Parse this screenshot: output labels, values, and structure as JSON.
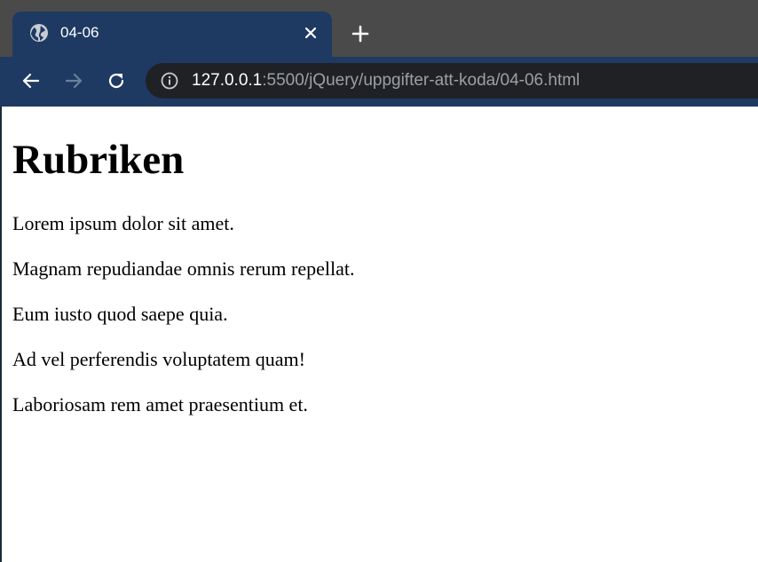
{
  "tab": {
    "title": "04-06",
    "favicon": "globe-icon",
    "close": "close-icon"
  },
  "toolbar": {
    "new_tab": "plus-icon",
    "back": "arrow-left-icon",
    "forward": "arrow-right-icon",
    "reload": "reload-icon",
    "info": "info-icon",
    "url_host": "127.0.0.1",
    "url_rest": ":5500/jQuery/uppgifter-att-koda/04-06.html"
  },
  "page": {
    "heading": "Rubriken",
    "paragraphs": [
      "Lorem ipsum dolor sit amet.",
      "Magnam repudiandae omnis rerum repellat.",
      "Eum iusto quod saepe quia.",
      "Ad vel perferendis voluptatem quam!",
      "Laboriosam rem amet praesentium et."
    ]
  },
  "colors": {
    "tab_strip": "#4a4a4a",
    "active_tab": "#1e3a63",
    "toolbar": "#1e3a63",
    "omnibox": "#202124",
    "url_host": "#ffffff",
    "url_rest": "#9aa0a6",
    "page_background": "#ffffff",
    "text": "#000000"
  }
}
